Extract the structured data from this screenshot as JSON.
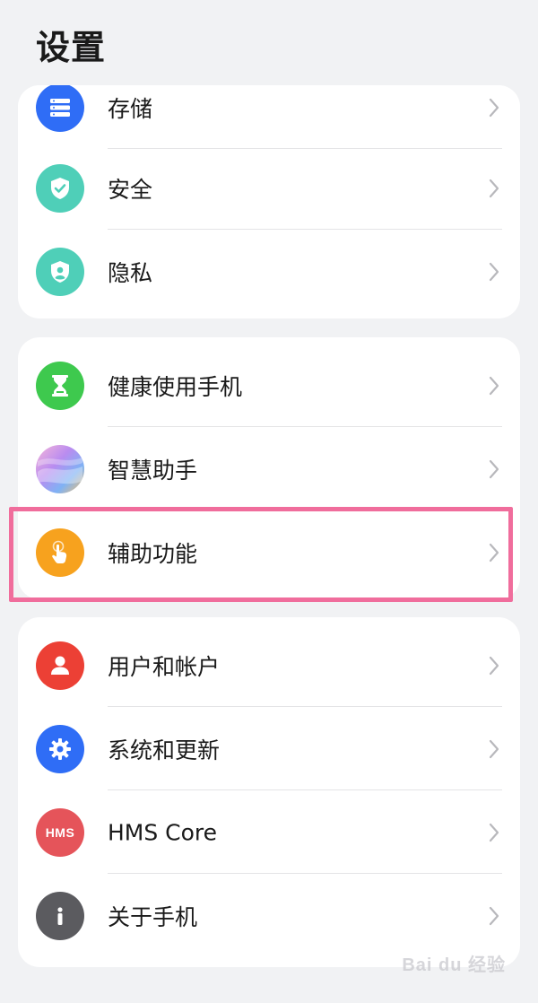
{
  "header": {
    "title": "设置"
  },
  "groups": [
    {
      "items": [
        {
          "label": "存储",
          "icon": "storage-icon",
          "color": "#2f6df6"
        },
        {
          "label": "安全",
          "icon": "shield-check-icon",
          "color": "#4fcfb8"
        },
        {
          "label": "隐私",
          "icon": "privacy-shield-icon",
          "color": "#4fcfb8"
        }
      ]
    },
    {
      "items": [
        {
          "label": "健康使用手机",
          "icon": "hourglass-icon",
          "color": "#3ec94e"
        },
        {
          "label": "智慧助手",
          "icon": "smart-assistant-icon",
          "color": "#b98cf0"
        },
        {
          "label": "辅助功能",
          "icon": "touch-hand-icon",
          "color": "#f7a21e"
        }
      ]
    },
    {
      "items": [
        {
          "label": "用户和帐户",
          "icon": "user-icon",
          "color": "#ec4035"
        },
        {
          "label": "系统和更新",
          "icon": "gear-icon",
          "color": "#2f6df6"
        },
        {
          "label": "HMS Core",
          "icon": "hms-icon",
          "icon_text": "HMS",
          "color": "#e5545a"
        },
        {
          "label": "关于手机",
          "icon": "info-icon",
          "color": "#5b5b5f"
        }
      ]
    }
  ],
  "highlight_color": "#f06d9c",
  "watermark": {
    "text": "Bai du 经验"
  }
}
